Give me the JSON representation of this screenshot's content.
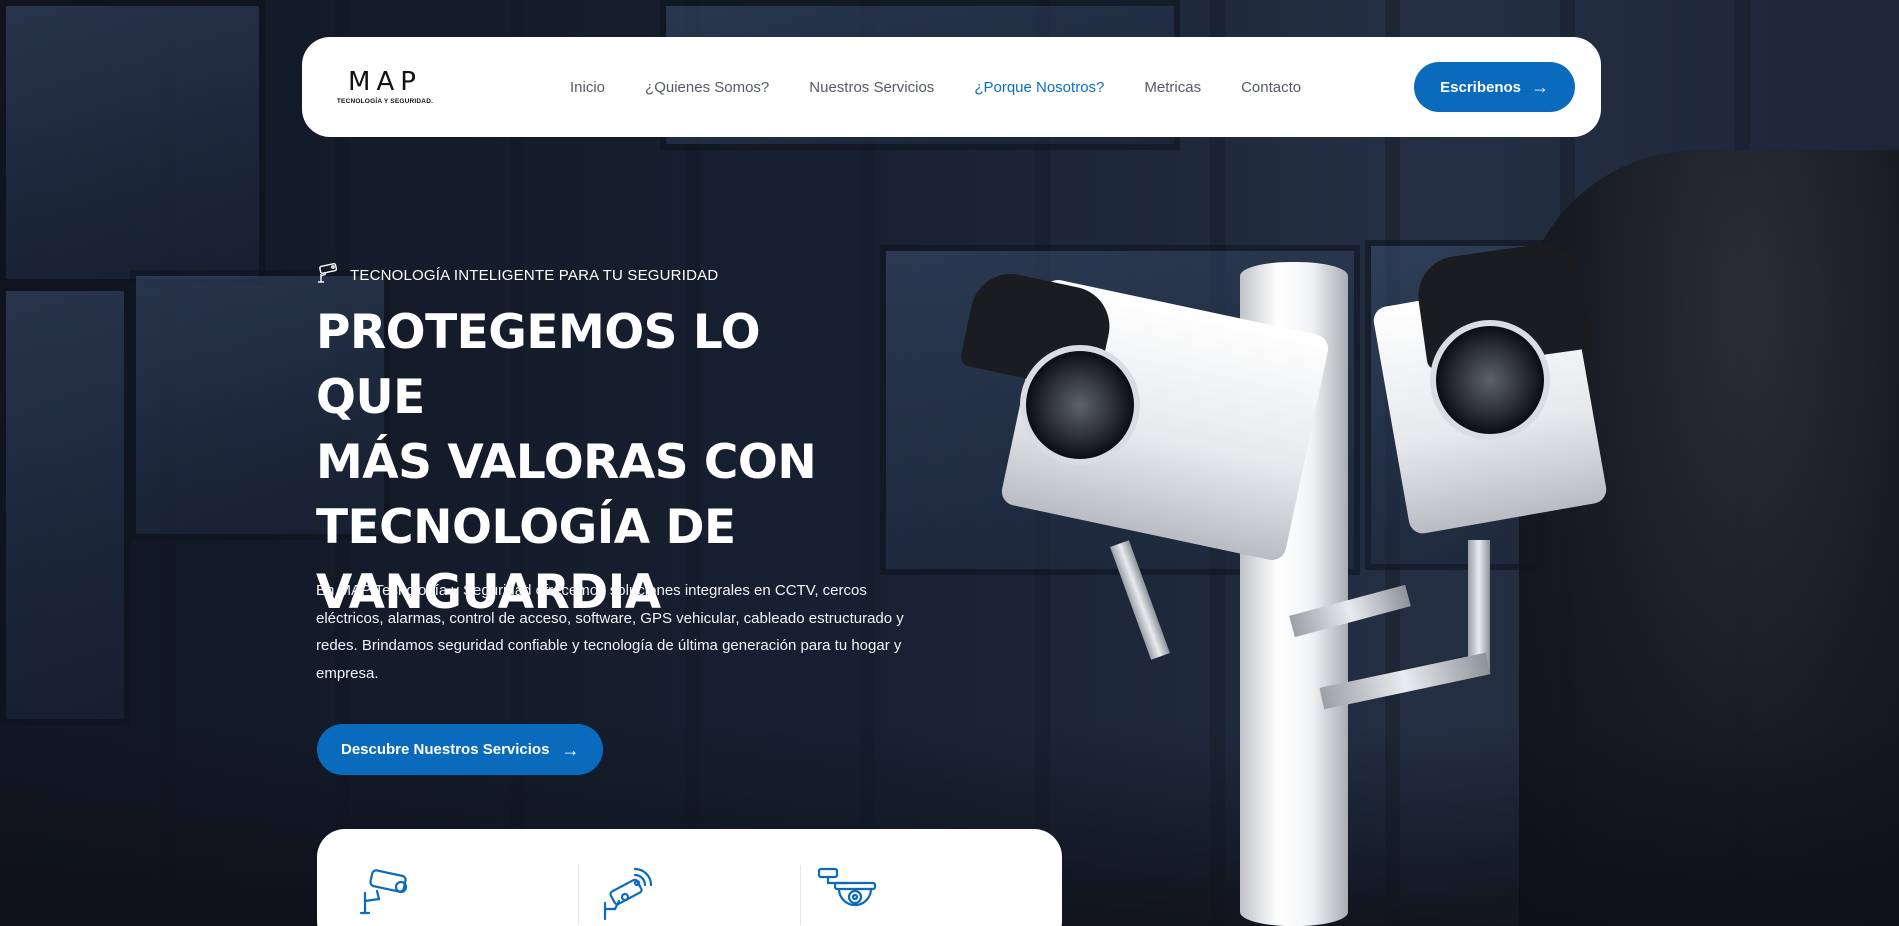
{
  "brand": {
    "logo_mark": "MAP",
    "logo_sub": "TECNOLOGÍA Y SEGURIDAD."
  },
  "nav": {
    "items": [
      {
        "label": "Inicio",
        "active": false
      },
      {
        "label": "¿Quienes Somos?",
        "active": false
      },
      {
        "label": "Nuestros Servicios",
        "active": false
      },
      {
        "label": "¿Porque Nosotros?",
        "active": true
      },
      {
        "label": "Metricas",
        "active": false
      },
      {
        "label": "Contacto",
        "active": false
      }
    ],
    "cta_label": "Escribenos"
  },
  "hero": {
    "tagline": "TECNOLOGÍA INTELIGENTE PARA TU SEGURIDAD",
    "headline_lines": [
      "PROTEGEMOS LO QUE",
      "MÁS VALORAS CON",
      "TECNOLOGÍA DE",
      "VANGUARDIA"
    ],
    "description": "En MAP Tecnología y Seguridad ofrecemos soluciones integrales en CCTV, cercos eléctricos, alarmas, control de acceso, software, GPS vehicular, cableado estructurado y redes. Brindamos seguridad confiable y tecnología de última generación para tu hogar y empresa.",
    "button_label": "Descubre Nuestros Servicios"
  },
  "features": [
    {
      "icon": "cctv-camera-icon"
    },
    {
      "icon": "wireless-camera-icon"
    },
    {
      "icon": "dome-camera-icon"
    }
  ],
  "colors": {
    "accent": "#0a6bbd",
    "nav_active": "#0a6fc2",
    "nav_text": "#555b66"
  }
}
